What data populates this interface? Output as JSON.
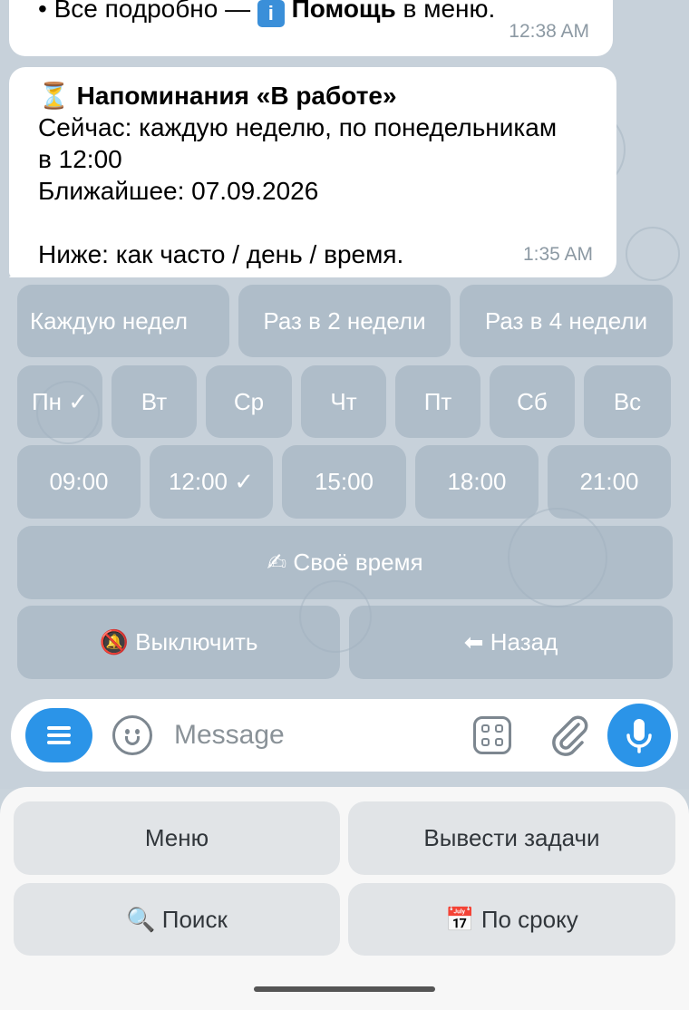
{
  "messages": {
    "top": {
      "text_prefix": "• Все подробно — ",
      "info_glyph": "i",
      "link_bold": "Помощь",
      "text_suffix": " в меню.",
      "time": "12:38 AM"
    },
    "main": {
      "emoji": "⏳",
      "title": "Напоминания «В работе»",
      "line1": "Сейчас: каждую неделю, по понедельникам",
      "line2": "в 12:00",
      "line3": "Ближайшее: 07.09.2026",
      "line4": "Ниже: как часто / день / время.",
      "time": "1:35 AM"
    }
  },
  "inline_keyboard": {
    "frequency": [
      "Каждую недел",
      "Раз в 2 недели",
      "Раз в 4 недели"
    ],
    "days": [
      "Пн ✓",
      "Вт",
      "Ср",
      "Чт",
      "Пт",
      "Сб",
      "Вс"
    ],
    "times": [
      "09:00",
      "12:00 ✓",
      "15:00",
      "18:00",
      "21:00"
    ],
    "custom_time": "✍ Своё время",
    "disable": "🔕 Выключить",
    "back": "⬅ Назад"
  },
  "input": {
    "placeholder": "Message",
    "icons": [
      "menu-icon",
      "emoji-icon",
      "sticker-grid-icon",
      "attach-icon",
      "mic-icon"
    ]
  },
  "reply_keyboard": {
    "menu": "Меню",
    "show_tasks": "Вывести задачи",
    "search": "🔍 Поиск",
    "by_deadline": "📅 По сроку"
  },
  "colors": {
    "chat_bg": "#c7d1da",
    "accent": "#2b94e8",
    "inline_button": "#a0b0be",
    "time_text": "#8c99a3"
  }
}
